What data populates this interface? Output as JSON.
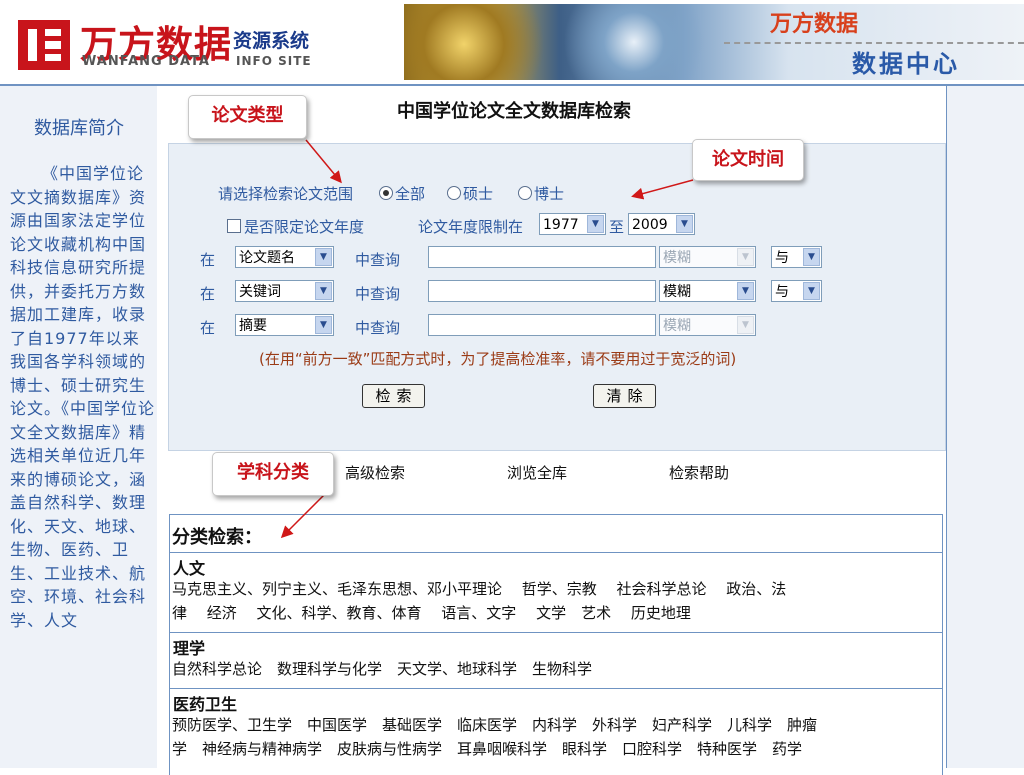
{
  "header": {
    "logo_cn": "万方数据",
    "logo_sub": "资源系统",
    "logo_en": "WANFANG DATA",
    "logo_info": "INFO SITE",
    "banner_brand": "万方数据",
    "banner_center": "数据中心"
  },
  "sidebar": {
    "title": "数据库简介",
    "intro": "《中国学位论文文摘数据库》资源由国家法定学位论文收藏机构中国科技信息研究所提供，并委托万方数据加工建库，收录了自1977年以来我国各学科领域的博士、硕士研究生论文。《中国学位论文全文数据库》精选相关单位近几年来的博硕论文，涵盖自然科学、数理化、天文、地球、生物、医药、卫生、工业技术、航空、环境、社会科学、人文"
  },
  "main": {
    "title": "中国学位论文全文数据库检索",
    "scope": {
      "label": "请选择检索论文范围",
      "options": [
        "全部",
        "硕士",
        "博士"
      ],
      "selected": "全部"
    },
    "year_limit": {
      "checkbox_label": "是否限定论文年度",
      "range_label": "论文年度限制在",
      "from": "1977",
      "to_label": "至",
      "to": "2009"
    },
    "rows": [
      {
        "prefix": "在",
        "field": "论文题名",
        "suffix": "中查询",
        "match": "模糊",
        "logic": "与"
      },
      {
        "prefix": "在",
        "field": "关键词",
        "suffix": "中查询",
        "match": "模糊",
        "logic": "与"
      },
      {
        "prefix": "在",
        "field": "摘要",
        "suffix": "中查询",
        "match": "模糊"
      }
    ],
    "hint": "(在用“前方一致”匹配方式时，为了提高检准率，请不要用过于宽泛的词)",
    "search_button": "检索",
    "clear_button": "清除",
    "nav": {
      "advanced": "高级检索",
      "browse": "浏览全库",
      "help": "检索帮助"
    },
    "classification": {
      "title": "分类检索：",
      "categories": [
        {
          "name": "人文",
          "lines": [
            "马克思主义、列宁主义、毛泽东思想、邓小平理论　 哲学、宗教　 社会科学总论　 政治、法",
            "律　 经济　 文化、科学、教育、体育　 语言、文字　 文学　艺术　 历史地理"
          ]
        },
        {
          "name": "理学",
          "lines": [
            "自然科学总论　数理科学与化学　天文学、地球科学　生物科学"
          ]
        },
        {
          "name": "医药卫生",
          "lines": [
            "预防医学、卫生学　中国医学　基础医学　临床医学　内科学　外科学　妇产科学　儿科学　肿瘤",
            "学　神经病与精神病学　皮肤病与性病学　耳鼻咽喉科学　眼科学　口腔科学　特种医学　药学"
          ]
        }
      ]
    }
  },
  "callouts": {
    "type": "论文类型",
    "time": "论文时间",
    "subject": "学科分类"
  },
  "colors": {
    "brand_red": "#c8141b",
    "link_blue": "#2f5aa0",
    "panel_bg": "#e9eff6",
    "hint_brown": "#9b3b16"
  }
}
